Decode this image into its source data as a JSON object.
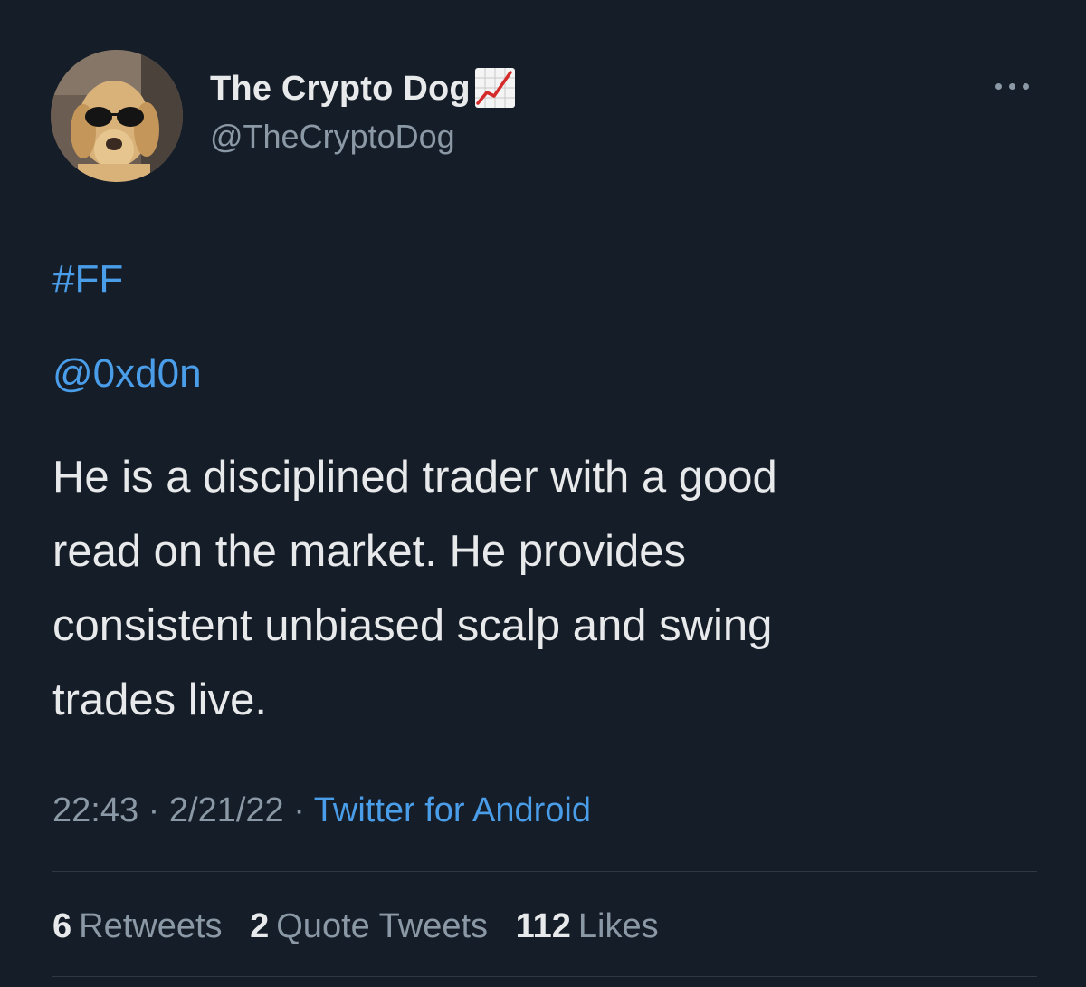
{
  "author": {
    "display_name": "The Crypto Dog",
    "badge_icon": "chart-increasing-icon",
    "handle": "@TheCryptoDog"
  },
  "menu_icon": "more-options-icon",
  "tweet": {
    "hashtag": "#FF",
    "mention": "@0xd0n",
    "body_lines": [
      "He is a disciplined trader with a good",
      "read on the market. He provides",
      "consistent unbiased scalp and swing",
      "trades live."
    ],
    "time": "22:43",
    "date": "2/21/22",
    "separator": "·",
    "source": "Twitter for Android"
  },
  "stats": {
    "retweets_count": "6",
    "retweets_label": "Retweets",
    "quotes_count": "2",
    "quotes_label": "Quote Tweets",
    "likes_count": "112",
    "likes_label": "Likes"
  },
  "colors": {
    "background": "#151d28",
    "text": "#e7e9ea",
    "secondary": "#8b98a5",
    "link": "#4a9de8",
    "emoji_line": "#d42a2a"
  }
}
